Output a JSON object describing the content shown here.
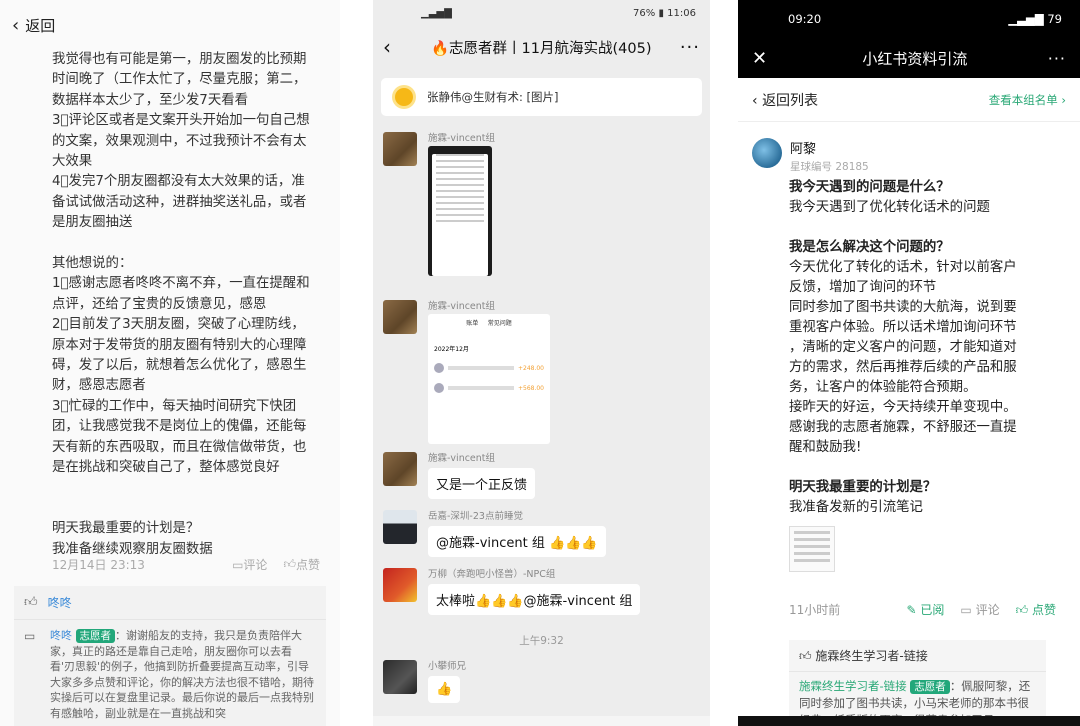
{
  "left": {
    "back_label": "返回",
    "lines": [
      "我觉得也有可能是第一，朋友圈发的比预期",
      "时间晚了（工作太忙了，尽量克服；第二，",
      "数据样本太少了，至少发7天看看",
      "3⃣评论区或者是文案开头开始加一句自己想",
      "的文案，效果观测中，不过我预计不会有太",
      "大效果",
      "4⃣发完7个朋友圈都没有太大效果的话，准",
      "备试试做活动这种，进群抽奖送礼品，或者",
      "是朋友圈抽送",
      "",
      "其他想说的：",
      "1⃣感谢志愿者咚咚不离不弃，一直在提醒和",
      "点评，还给了宝贵的反馈意见，感恩",
      "2⃣目前发了3天朋友圈，突破了心理防线，",
      "原本对于发带货的朋友圈有特别大的心理障",
      "碍，发了以后，就想着怎么优化了，感恩生",
      "财，感恩志愿者",
      "3⃣忙碌的工作中，每天抽时间研究下快团",
      "团，让我感觉我不是岗位上的傀儡，还能每",
      "天有新的东西吸取，而且在微信做带货，也",
      "是在挑战和突破自己了，整体感觉良好",
      "",
      "",
      "明天我最重要的计划是？",
      "我准备继续观察朋友圈数据"
    ],
    "timestamp": "12月14日 23:13",
    "comment_label": "评论",
    "like_label": "点赞",
    "liked_by": "咚咚",
    "comment_author": "咚咚",
    "comment_badge": "志愿者",
    "comment_text": "：谢谢船友的支持，我只是负责陪伴大家，真正的路还是靠自己走哈，朋友圈你可以去看看'刃思毅'的例子，他搞到防折叠要提高互动率，引导大家多多点赞和评论，你的解决方法也很不错哈，期待实操后可以在复盘里记录。最后你说的最后一点我特别有感触哈，副业就是在一直挑战和突"
  },
  "chat": {
    "status_battery": "76%",
    "status_time": "11:06",
    "title": "🔥志愿者群丨11月航海实战(405)",
    "pinned": "张静伟@生财有术: [图片]",
    "messages": [
      {
        "sender": "施霖-vincent组"
      },
      {
        "sender": "施霖-vincent组",
        "shot_title": "账单",
        "shot_tab": "常见问题",
        "shot_month": "2022年12月",
        "shot_v1": "+248.00",
        "shot_v2": "+568.00"
      },
      {
        "sender": "施霖-vincent组",
        "text": "又是一个正反馈"
      },
      {
        "sender": "岳嘉-深圳-23点前睡觉",
        "text": "@施霖-vincent 组 👍👍👍"
      },
      {
        "sender": "万柳（奔跑吧小怪兽）-NPC组",
        "text": "太棒啦👍👍👍@施霖-vincent 组"
      },
      {
        "sender": "小攀师兄",
        "text": "👍"
      }
    ],
    "time_divider": "上午9:32"
  },
  "right": {
    "status_time": "09:20",
    "status_battery": "79",
    "nav_title": "小红书资料引流",
    "back_label": "返回列表",
    "group_link": "查看本组名单",
    "author": "阿黎",
    "planet_id": "星球编号 28185",
    "content": [
      {
        "t": "我今天遇到的问题是什么？",
        "h": true
      },
      {
        "t": "我今天遇到了优化转化话术的问题",
        "h": false
      },
      {
        "t": "",
        "h": false
      },
      {
        "t": "我是怎么解决这个问题的？",
        "h": true
      },
      {
        "t": "今天优化了转化的话术，针对以前客户",
        "h": false
      },
      {
        "t": "反馈，增加了询问的环节",
        "h": false
      },
      {
        "t": "同时参加了图书共读的大航海，说到要",
        "h": false
      },
      {
        "t": "重视客户体验。所以话术增加询问环节",
        "h": false
      },
      {
        "t": "，清晰的定义客户的问题，才能知道对",
        "h": false
      },
      {
        "t": "方的需求，然后再推荐后续的产品和服",
        "h": false
      },
      {
        "t": "务，让客户的体验能符合预期。",
        "h": false
      },
      {
        "t": "接昨天的好运，今天持续开单变现中。",
        "h": false
      },
      {
        "t": "感谢我的志愿者施霖，不舒服还一直提",
        "h": false
      },
      {
        "t": "醒和鼓励我!",
        "h": false
      },
      {
        "t": "",
        "h": false
      },
      {
        "t": "明天我最重要的计划是？",
        "h": true
      },
      {
        "t": "我准备发新的引流笔记",
        "h": false
      }
    ],
    "time_ago": "11小时前",
    "read_label": "已阅",
    "comment_label": "评论",
    "like_label": "点赞",
    "liked_by": "施霖终生学习者-链接",
    "comment_author": "施霖终生学习者-链接",
    "comment_badge": "志愿者",
    "comment_text": "：佩服阿黎，还同时参加了图书共读，小马宋老师的那本书很经典，纸质版的更商，很荣幸参加了吕"
  }
}
